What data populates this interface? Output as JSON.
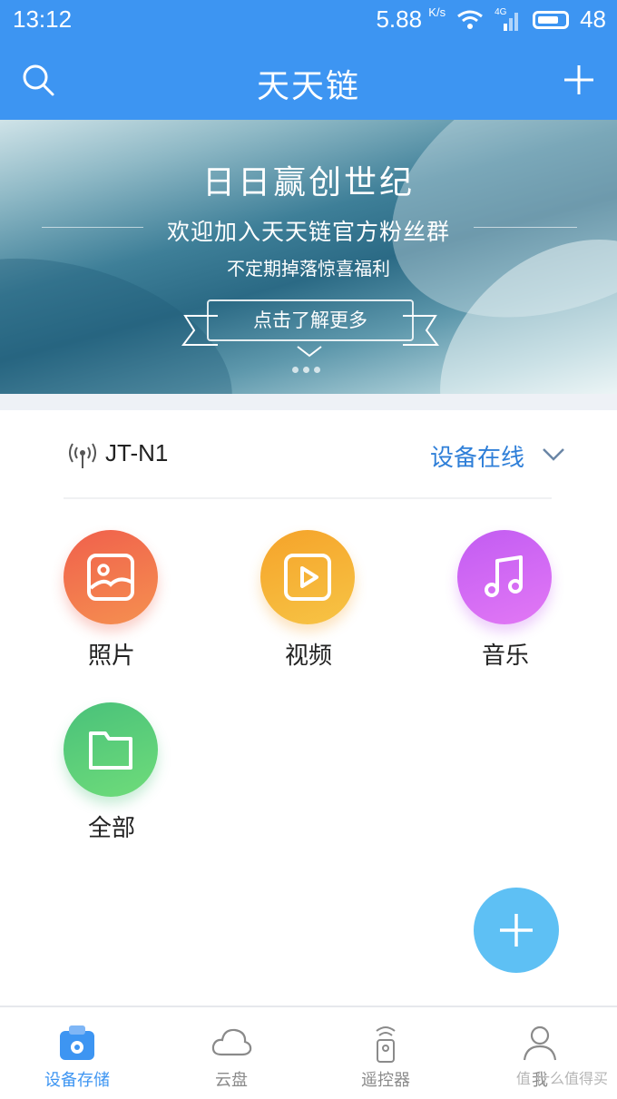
{
  "status_bar": {
    "time": "13:12",
    "net_speed": "5.88",
    "net_unit": "K/s",
    "signal": "4G",
    "battery": "48"
  },
  "app_bar": {
    "title": "天天链"
  },
  "banner": {
    "headline": "日日赢创世纪",
    "line1": "欢迎加入天天链官方粉丝群",
    "line2": "不定期掉落惊喜福利",
    "cta": "点击了解更多",
    "page_count": 3,
    "active_page": 1
  },
  "device": {
    "name": "JT-N1",
    "status": "设备在线"
  },
  "categories": [
    {
      "label": "照片",
      "icon": "photo-icon",
      "color_from": "#f0604c",
      "color_to": "#f59050"
    },
    {
      "label": "视频",
      "icon": "video-icon",
      "color_from": "#f5a32a",
      "color_to": "#f7c445"
    },
    {
      "label": "音乐",
      "icon": "music-icon",
      "color_from": "#c25cf2",
      "color_to": "#e278f5"
    },
    {
      "label": "全部",
      "icon": "folder-icon",
      "color_from": "#49c17a",
      "color_to": "#6fdc7a"
    }
  ],
  "tabs": [
    {
      "label": "设备存储",
      "icon": "storage-icon",
      "active": true
    },
    {
      "label": "云盘",
      "icon": "cloud-icon",
      "active": false
    },
    {
      "label": "遥控器",
      "icon": "remote-icon",
      "active": false
    },
    {
      "label": "我",
      "icon": "user-icon",
      "active": false
    }
  ],
  "watermark": "值 什么值得买",
  "colors": {
    "primary": "#3d95f2",
    "fab": "#5ec0f4",
    "device_status": "#2f7fd8"
  }
}
